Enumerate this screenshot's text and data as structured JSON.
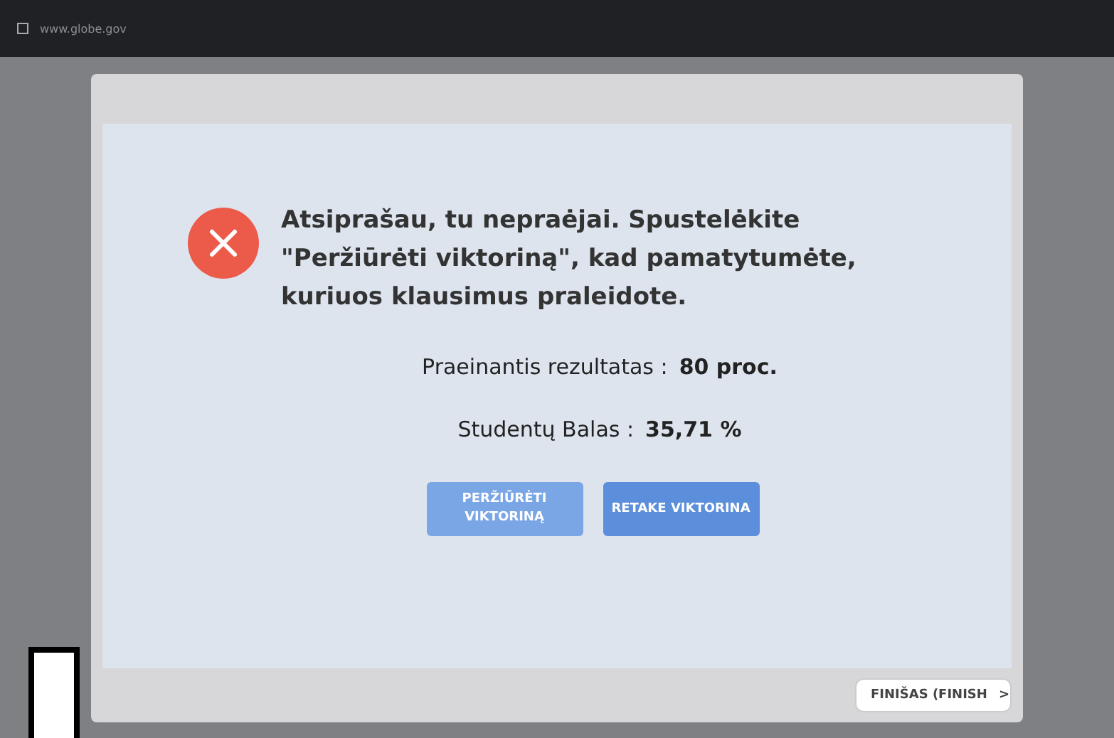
{
  "browser": {
    "url": "www.globe.gov"
  },
  "result": {
    "message": "Atsiprašau, tu nepraėjai. Spustelėkite \"Peržiūrėti viktoriną\", kad pamatytumėte, kuriuos klausimus praleidote.",
    "rows": [
      {
        "label": "Praeinantis rezultatas :",
        "value": "80 proc."
      },
      {
        "label": "Studentų Balas :",
        "value": "35,71 %"
      }
    ],
    "buttons": [
      "PERŽIŪRĖTI VIKTORINĄ",
      "RETAKE VIKTORINA"
    ]
  },
  "footer": {
    "finish": "FINIŠAS (FINISH",
    "finish_icon": ">"
  }
}
